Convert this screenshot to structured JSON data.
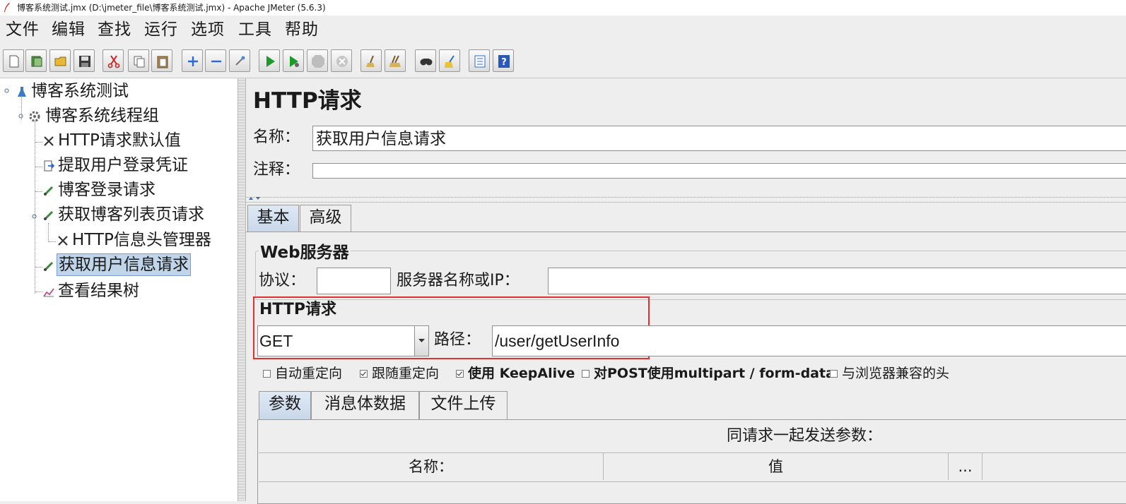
{
  "window": {
    "title": "博客系统测试.jmx (D:\\jmeter_file\\博客系统测试.jmx) - Apache JMeter (5.6.3)"
  },
  "menu": [
    "文件",
    "编辑",
    "查找",
    "运行",
    "选项",
    "工具",
    "帮助"
  ],
  "toolbar": [
    {
      "name": "new-icon"
    },
    {
      "name": "templates-icon"
    },
    {
      "name": "open-icon"
    },
    {
      "name": "save-icon"
    },
    {
      "name": "cut-icon"
    },
    {
      "name": "copy-icon"
    },
    {
      "name": "paste-icon"
    },
    {
      "name": "expand-icon"
    },
    {
      "name": "collapse-icon"
    },
    {
      "name": "toggle-icon"
    },
    {
      "name": "start-icon"
    },
    {
      "name": "start-no-pause-icon"
    },
    {
      "name": "stop-icon"
    },
    {
      "name": "shutdown-icon"
    },
    {
      "name": "clear-icon"
    },
    {
      "name": "clear-all-icon"
    },
    {
      "name": "search-icon"
    },
    {
      "name": "reset-search-icon"
    },
    {
      "name": "function-helper-icon"
    },
    {
      "name": "help-icon"
    }
  ],
  "tree": {
    "nodes": [
      {
        "label": "博客系统测试",
        "icon": "test-plan-icon"
      },
      {
        "label": "博客系统线程组",
        "icon": "thread-group-icon"
      },
      {
        "label": "HTTP请求默认值",
        "icon": "config-element-icon"
      },
      {
        "label": "提取用户登录凭证",
        "icon": "extractor-icon"
      },
      {
        "label": "博客登录请求",
        "icon": "sampler-icon"
      },
      {
        "label": "获取博客列表页请求",
        "icon": "sampler-icon"
      },
      {
        "label": "HTTP信息头管理器",
        "icon": "config-element-icon"
      },
      {
        "label": "获取用户信息请求",
        "icon": "sampler-icon",
        "selected": true
      },
      {
        "label": "查看结果树",
        "icon": "listener-icon"
      }
    ]
  },
  "panel": {
    "title": "HTTP请求",
    "name_label": "名称：",
    "name_value": "获取用户信息请求",
    "comment_label": "注释：",
    "comment_value": "",
    "tabs": [
      "基本",
      "高级"
    ],
    "web_server": {
      "legend": "Web服务器",
      "protocol_label": "协议：",
      "protocol_value": "",
      "server_label": "服务器名称或IP：",
      "server_value": ""
    },
    "http_request": {
      "legend": "HTTP请求",
      "method": "GET",
      "path_label": "路径：",
      "path_value": "/user/getUserInfo"
    },
    "options": [
      {
        "label": "自动重定向",
        "checked": false
      },
      {
        "label": "跟随重定向",
        "checked": true
      },
      {
        "label": "使用 KeepAlive",
        "checked": true
      },
      {
        "label": "对POST使用multipart / form-data",
        "checked": false
      },
      {
        "label": "与浏览器兼容的头",
        "checked": false
      }
    ],
    "sub_tabs": [
      "参数",
      "消息体数据",
      "文件上传"
    ],
    "params": {
      "caption": "同请求一起发送参数：",
      "columns": [
        "名称：",
        "值",
        "..."
      ]
    }
  },
  "colors": {
    "highlight_border": "#e03030",
    "selection": "#c0d4ea"
  }
}
